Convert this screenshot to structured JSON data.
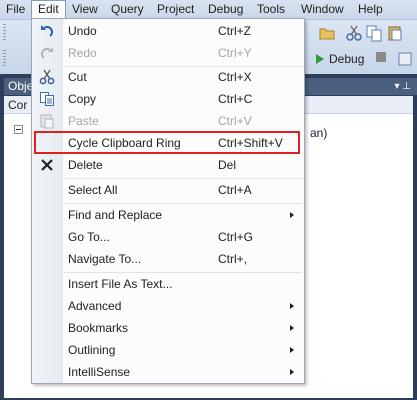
{
  "menubar": {
    "items": [
      "File",
      "Edit",
      "View",
      "Query",
      "Project",
      "Debug",
      "Tools",
      "Window",
      "Help"
    ],
    "active": "Edit"
  },
  "toolbar": {
    "debug_label": "Debug"
  },
  "panel": {
    "title_partial": "Obje",
    "combo_partial": "Cor",
    "tree_text_partial": "an)"
  },
  "edit_menu": {
    "items": [
      {
        "label": "Undo",
        "shortcut": "Ctrl+Z",
        "icon": "undo-icon",
        "enabled": true
      },
      {
        "label": "Redo",
        "shortcut": "Ctrl+Y",
        "icon": "redo-icon",
        "enabled": false
      },
      {
        "label": "Cut",
        "shortcut": "Ctrl+X",
        "icon": "cut-icon",
        "enabled": true
      },
      {
        "label": "Copy",
        "shortcut": "Ctrl+C",
        "icon": "copy-icon",
        "enabled": true
      },
      {
        "label": "Paste",
        "shortcut": "Ctrl+V",
        "icon": "paste-icon",
        "enabled": false
      },
      {
        "label": "Cycle Clipboard Ring",
        "shortcut": "Ctrl+Shift+V",
        "enabled": true,
        "highlighted_by_red_box": true
      },
      {
        "label": "Delete",
        "shortcut": "Del",
        "icon": "delete-icon",
        "enabled": true
      },
      {
        "label": "Select All",
        "shortcut": "Ctrl+A",
        "enabled": true
      },
      {
        "label": "Find and Replace",
        "submenu": true,
        "enabled": true
      },
      {
        "label": "Go To...",
        "shortcut": "Ctrl+G",
        "enabled": true
      },
      {
        "label": "Navigate To...",
        "shortcut": "Ctrl+,",
        "enabled": true
      },
      {
        "label": "Insert File As Text...",
        "enabled": true
      },
      {
        "label": "Advanced",
        "submenu": true,
        "enabled": true
      },
      {
        "label": "Bookmarks",
        "submenu": true,
        "enabled": true
      },
      {
        "label": "Outlining",
        "submenu": true,
        "enabled": true
      },
      {
        "label": "IntelliSense",
        "submenu": true,
        "enabled": true
      }
    ]
  },
  "colors": {
    "highlight_box": "#e02020",
    "disabled_text": "#a5a5a5",
    "menubar": "#d9e3f0"
  }
}
